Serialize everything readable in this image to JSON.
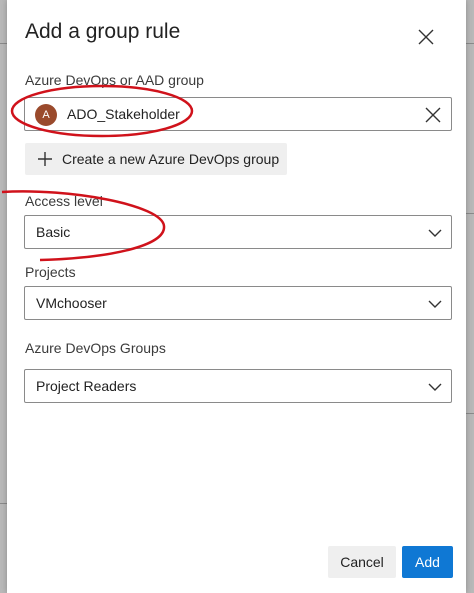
{
  "dialog": {
    "title": "Add a group rule",
    "close_icon": "close-icon"
  },
  "group_field": {
    "label": "Azure DevOps or AAD group",
    "avatar_initial": "A",
    "selected": "ADO_Stakeholder",
    "clear_icon": "close-icon"
  },
  "create_group_button": {
    "label": "Create a new Azure DevOps group",
    "icon": "plus-icon"
  },
  "access_level": {
    "label": "Access level",
    "value": "Basic"
  },
  "projects": {
    "label": "Projects",
    "value": "VMchooser"
  },
  "devops_groups": {
    "label": "Azure DevOps Groups",
    "value": "Project Readers"
  },
  "footer": {
    "cancel_label": "Cancel",
    "add_label": "Add"
  },
  "colors": {
    "primary": "#0f78d4",
    "annotation": "#d0121b",
    "avatar": "#9a4a2c"
  }
}
